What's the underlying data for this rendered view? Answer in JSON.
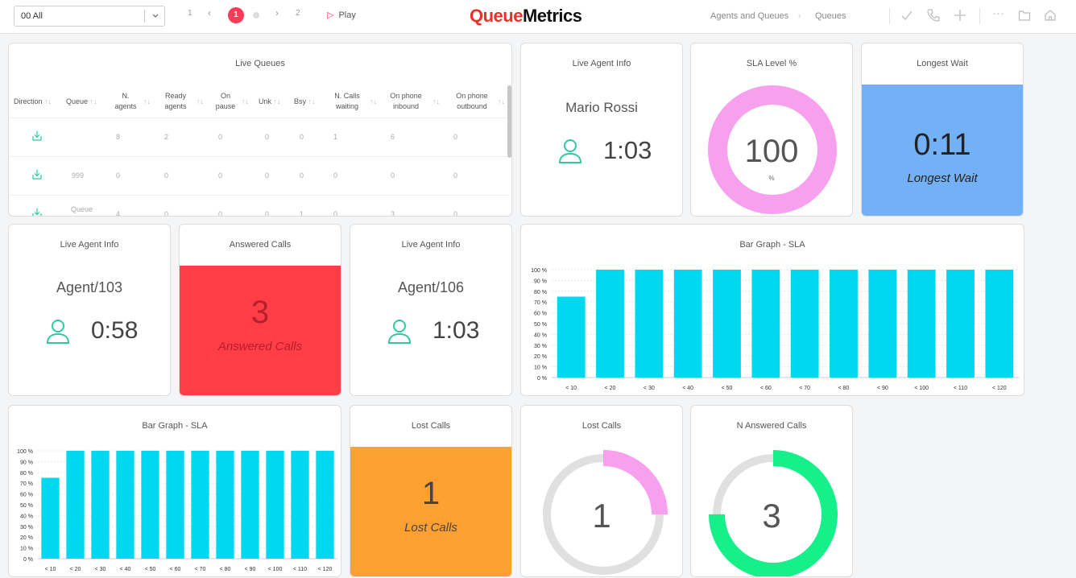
{
  "topbar": {
    "selector_value": "00 All",
    "pager": {
      "first": "1",
      "prev": "‹",
      "current": "1",
      "next": "›",
      "last": "2"
    },
    "play_label": "Play",
    "logo": {
      "queue": "Queue",
      "metrics": "Metrics"
    },
    "breadcrumb": [
      "Agents and Queues",
      "Queues"
    ],
    "icons": [
      "check-icon",
      "phone-icon",
      "plus-icon",
      "more-icon",
      "folder-icon",
      "home-icon"
    ]
  },
  "live_queues": {
    "title": "Live Queues",
    "columns": [
      "Direction",
      "Queue",
      "N. agents",
      "Ready agents",
      "On pause",
      "Unk",
      "Bsy",
      "N. Calls waiting",
      "On phone inbound",
      "On phone outbound"
    ],
    "rows": [
      {
        "queue": "",
        "n_agents": "8",
        "ready": "2",
        "pause": "0",
        "unk": "0",
        "bsy": "0",
        "waiting": "1",
        "inbound": "6",
        "outbound": "0"
      },
      {
        "queue": "999",
        "n_agents": "0",
        "ready": "0",
        "pause": "0",
        "unk": "0",
        "bsy": "0",
        "waiting": "0",
        "inbound": "0",
        "outbound": "0"
      },
      {
        "queue": "Queue",
        "n_agents": "4",
        "ready": "0",
        "pause": "0",
        "unk": "0",
        "bsy": "1",
        "waiting": "0",
        "inbound": "3",
        "outbound": "0"
      }
    ]
  },
  "agent1": {
    "title": "Live Agent Info",
    "name": "Mario Rossi",
    "time": "1:03"
  },
  "sla_level": {
    "title": "SLA Level %",
    "value": "100",
    "unit": "%"
  },
  "longest_wait": {
    "title": "Longest Wait",
    "value": "0:11",
    "label": "Longest Wait",
    "color": "#74b0f5"
  },
  "agent2": {
    "title": "Live Agent Info",
    "name": "Agent/103",
    "time": "0:58"
  },
  "answered": {
    "title": "Answered Calls",
    "value": "3",
    "label": "Answered Calls",
    "color": "#ff3d47"
  },
  "agent3": {
    "title": "Live Agent Info",
    "name": "Agent/106",
    "time": "1:03"
  },
  "bar_sla_1": {
    "title": "Bar Graph - SLA"
  },
  "bar_sla_2": {
    "title": "Bar Graph - SLA"
  },
  "lost_box": {
    "title": "Lost Calls",
    "value": "1",
    "label": "Lost Calls",
    "color": "#ffa033"
  },
  "lost_donut": {
    "title": "Lost Calls",
    "value": "1"
  },
  "n_answered": {
    "title": "N Answered Calls",
    "value": "3"
  },
  "chart_data": [
    {
      "type": "bar",
      "title": "Bar Graph - SLA",
      "categories": [
        "< 10",
        "< 20",
        "< 30",
        "< 40",
        "< 50",
        "< 60",
        "< 70",
        "< 80",
        "< 90",
        "< 100",
        "< 110",
        "< 120"
      ],
      "values": [
        75,
        100,
        100,
        100,
        100,
        100,
        100,
        100,
        100,
        100,
        100,
        100
      ],
      "yticks": [
        "0 %",
        "10 %",
        "20 %",
        "30 %",
        "40 %",
        "50 %",
        "60 %",
        "70 %",
        "80 %",
        "90 %",
        "100 %"
      ],
      "ylim": [
        0,
        100
      ],
      "color": "#00d8f0"
    },
    {
      "type": "bar",
      "title": "Bar Graph - SLA",
      "categories": [
        "< 10",
        "< 20",
        "< 30",
        "< 40",
        "< 50",
        "< 60",
        "< 70",
        "< 80",
        "< 90",
        "< 100",
        "< 110",
        "< 120"
      ],
      "values": [
        75,
        100,
        100,
        100,
        100,
        100,
        100,
        100,
        100,
        100,
        100,
        100
      ],
      "yticks": [
        "0 %",
        "10 %",
        "20 %",
        "30 %",
        "40 %",
        "50 %",
        "60 %",
        "70 %",
        "80 %",
        "90 %",
        "100 %"
      ],
      "ylim": [
        0,
        100
      ],
      "color": "#00d8f0"
    }
  ],
  "donuts": {
    "sla_fraction": 1.0,
    "sla_color": "#f7a1ee",
    "lost_fraction": 0.25,
    "lost_color": "#f7a1ee",
    "answered_fraction": 0.75,
    "answered_color": "#16f08a",
    "track_color": "#e0e0e0"
  }
}
